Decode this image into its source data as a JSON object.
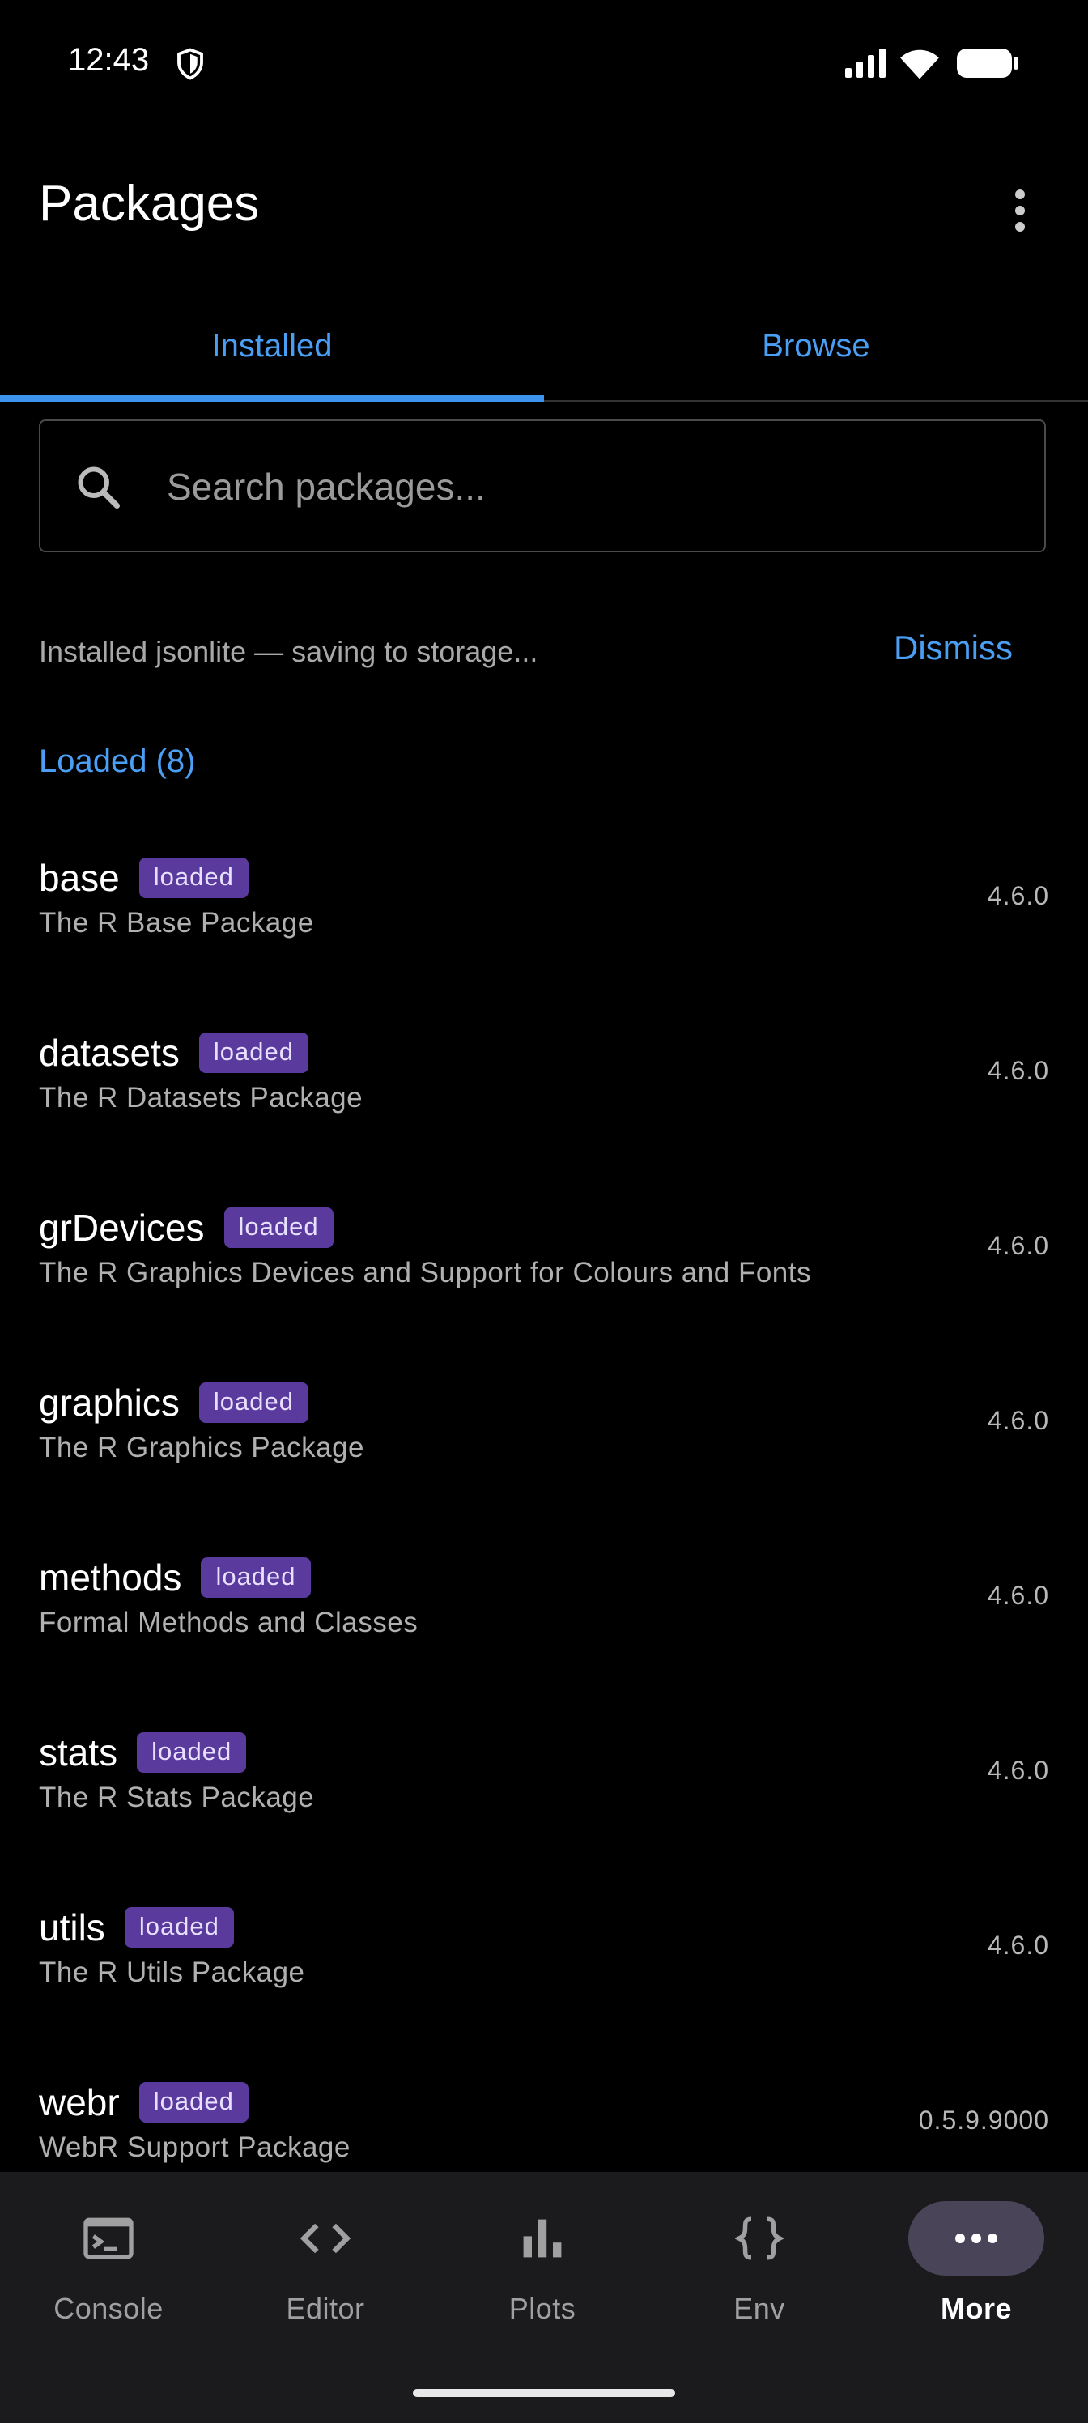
{
  "status_bar": {
    "time": "12:43"
  },
  "app_bar": {
    "title": "Packages"
  },
  "tabs": [
    {
      "label": "Installed",
      "selected": true
    },
    {
      "label": "Browse",
      "selected": false
    }
  ],
  "search": {
    "placeholder": "Search packages...",
    "value": ""
  },
  "notice": {
    "text": "Installed jsonlite — saving to storage...",
    "dismiss_label": "Dismiss"
  },
  "section": {
    "label": "Loaded (8)"
  },
  "packages": [
    {
      "name": "base",
      "badge": "loaded",
      "description": "The R Base Package",
      "version": "4.6.0"
    },
    {
      "name": "datasets",
      "badge": "loaded",
      "description": "The R Datasets Package",
      "version": "4.6.0"
    },
    {
      "name": "grDevices",
      "badge": "loaded",
      "description": "The R Graphics Devices and Support for Colours and Fonts",
      "version": "4.6.0"
    },
    {
      "name": "graphics",
      "badge": "loaded",
      "description": "The R Graphics Package",
      "version": "4.6.0"
    },
    {
      "name": "methods",
      "badge": "loaded",
      "description": "Formal Methods and Classes",
      "version": "4.6.0"
    },
    {
      "name": "stats",
      "badge": "loaded",
      "description": "The R Stats Package",
      "version": "4.6.0"
    },
    {
      "name": "utils",
      "badge": "loaded",
      "description": "The R Utils Package",
      "version": "4.6.0"
    },
    {
      "name": "webr",
      "badge": "loaded",
      "description": "WebR Support Package",
      "version": "0.5.9.9000"
    }
  ],
  "bottom_nav": [
    {
      "label": "Console",
      "icon": "terminal-icon",
      "active": false
    },
    {
      "label": "Editor",
      "icon": "code-icon",
      "active": false
    },
    {
      "label": "Plots",
      "icon": "bar-chart-icon",
      "active": false
    },
    {
      "label": "Env",
      "icon": "braces-icon",
      "active": false
    },
    {
      "label": "More",
      "icon": "more-horiz-icon",
      "active": true
    }
  ],
  "colors": {
    "accent": "#4a9ff5",
    "badge_bg": "#5a3a9c",
    "nav_active_bg": "#4a4458",
    "background": "#000000"
  }
}
